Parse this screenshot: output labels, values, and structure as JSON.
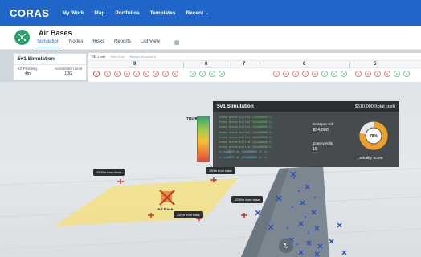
{
  "topnav": {
    "logo": "CORAS",
    "items": [
      "My Work",
      "Map",
      "Portfolios",
      "Templates",
      "Recent"
    ],
    "recent_caret": "⌄"
  },
  "header": {
    "title": "Air Bases",
    "tabs": [
      "Simulation",
      "Nodes",
      "Risks",
      "Reports",
      "List View"
    ],
    "active_tab": "Simulation"
  },
  "sim_summary": {
    "title": "5v1 Simulation",
    "kill_proximity_label": "Kill Proximity",
    "kill_proximity_value": "4m",
    "acceleration_limit_label": "Acceleration Limit",
    "acceleration_limit_value": "10G"
  },
  "trl_strip": {
    "tabs": [
      "TRL Level",
      "Total Cost",
      "Mission Success #"
    ],
    "levels": [
      "9",
      "8",
      "7",
      "6",
      "5"
    ],
    "dot_colors": {
      "red": "#e27a7a",
      "green": "#7cc49a"
    }
  },
  "popup": {
    "title": "5v1 Simulation",
    "total_cost": "$510,000 (total cost)",
    "log": [
      "Enemy drone killed (SQUADRON 1)",
      "Enemy drone killed (SQUADRON 1)",
      "Enemy drone killed (SQUADRON 1)",
      "Enemy drone killed (SQUADRON 1)",
      "Enemy drone killed (SQUADRON 1)",
      "Enemy drone killed (SQUADRON 1)",
      "Enemy drone killed (SQUADRON 1)",
      "=> LAUNCH at (SQUADRON 4) <=",
      "=> LAUNCH at (SQUADRON 3) <="
    ],
    "cost_per_kill_label": "Cost per Kill",
    "cost_per_kill_value": "$34,000",
    "enemy_kills_label": "Enemy Kills",
    "enemy_kills_value": "15",
    "lethality_label": "Lethality Score",
    "lethality_value": "78%",
    "lethality_fraction": 0.78,
    "gauge_color": "#f0a02a"
  },
  "trl_indicator": {
    "label": "TRL 9"
  },
  "scene": {
    "airbase_label": "Air Base",
    "distance_labels": [
      "1500m from base",
      "350m from base",
      "1250m from base",
      "250m from base"
    ],
    "colors": {
      "zone": "#f3e08a",
      "drone_enemy": "#c0392b",
      "drone_friendly": "#2d4db8"
    }
  }
}
